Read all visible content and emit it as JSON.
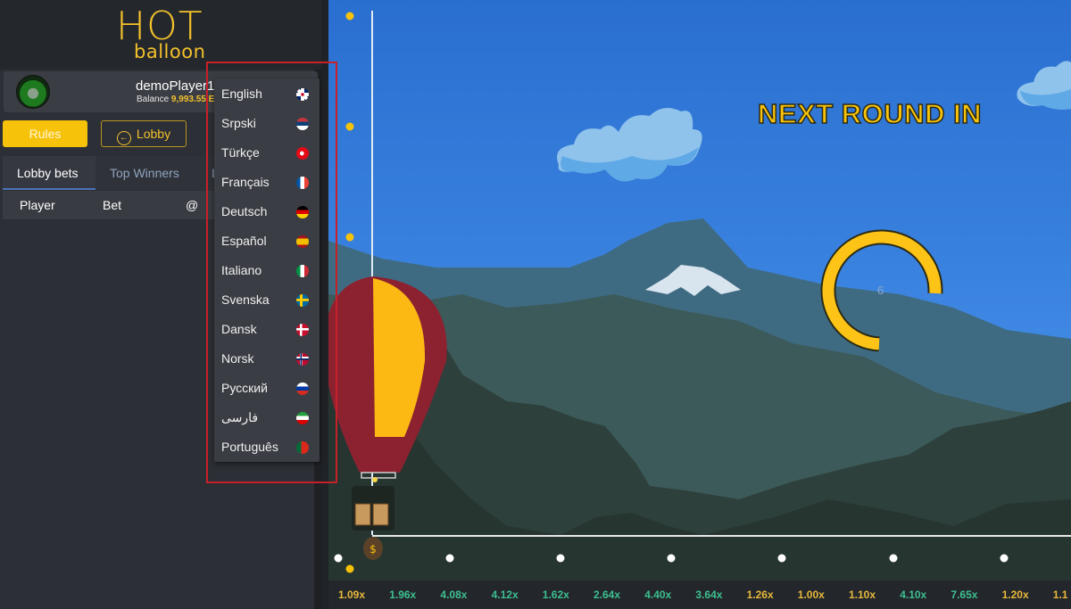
{
  "logo": {
    "line1": "HOT",
    "line2": "balloon"
  },
  "player": {
    "name": "demoPlayer1",
    "balance_label": "Balance",
    "balance_value": "9,993.55 E"
  },
  "buttons": {
    "rules": "Rules",
    "lobby": "Lobby"
  },
  "tabs": [
    {
      "label": "Lobby bets",
      "active": true
    },
    {
      "label": "Top Winners",
      "active": false
    },
    {
      "label": "L",
      "active": false
    }
  ],
  "table": {
    "headers": [
      "Player",
      "Bet",
      "@"
    ],
    "rows": []
  },
  "language_menu": {
    "items": [
      {
        "label": "English",
        "flag": "uk"
      },
      {
        "label": "Srpski",
        "flag": "rs"
      },
      {
        "label": "Türkçe",
        "flag": "tr"
      },
      {
        "label": "Français",
        "flag": "fr"
      },
      {
        "label": "Deutsch",
        "flag": "de"
      },
      {
        "label": "Español",
        "flag": "es"
      },
      {
        "label": "Italiano",
        "flag": "it"
      },
      {
        "label": "Svenska",
        "flag": "se"
      },
      {
        "label": "Dansk",
        "flag": "dk"
      },
      {
        "label": "Norsk",
        "flag": "no"
      },
      {
        "label": "Русский",
        "flag": "ru"
      },
      {
        "label": "فارسی",
        "flag": "ir"
      },
      {
        "label": "Português",
        "flag": "pt"
      }
    ]
  },
  "game": {
    "banner": "NEXT ROUND IN",
    "countdown": "6",
    "countdown_fraction": 0.75,
    "colors": {
      "accent": "#f7c20a",
      "low_mult": "#e8b83a",
      "high_mult": "#3dbf8f",
      "balloon_red": "#8c2230",
      "balloon_yellow": "#fdb913"
    }
  },
  "multipliers": [
    {
      "value": "1.09x",
      "tier": "low"
    },
    {
      "value": "1.96x",
      "tier": "high"
    },
    {
      "value": "4.08x",
      "tier": "high"
    },
    {
      "value": "4.12x",
      "tier": "high"
    },
    {
      "value": "1.62x",
      "tier": "high"
    },
    {
      "value": "2.64x",
      "tier": "high"
    },
    {
      "value": "4.40x",
      "tier": "high"
    },
    {
      "value": "3.64x",
      "tier": "high"
    },
    {
      "value": "1.26x",
      "tier": "low"
    },
    {
      "value": "1.00x",
      "tier": "low"
    },
    {
      "value": "1.10x",
      "tier": "low"
    },
    {
      "value": "4.10x",
      "tier": "high"
    },
    {
      "value": "7.65x",
      "tier": "high"
    },
    {
      "value": "1.20x",
      "tier": "low"
    },
    {
      "value": "1.1",
      "tier": "low"
    }
  ]
}
